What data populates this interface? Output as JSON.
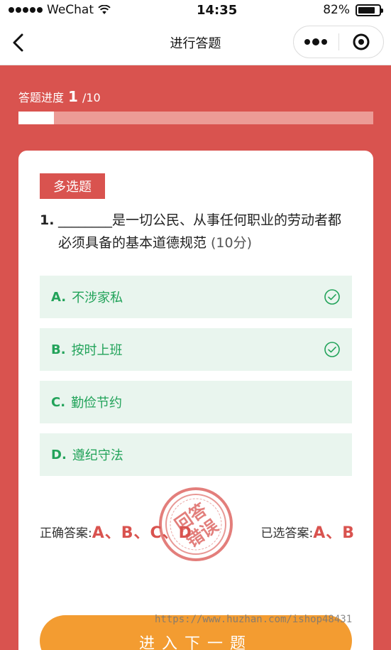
{
  "status_bar": {
    "carrier": "WeChat",
    "time": "14:35",
    "battery": "82%",
    "battery_level": 0.82
  },
  "nav": {
    "title": "进行答题"
  },
  "progress": {
    "label": "答题进度",
    "current": "1",
    "total": "/10",
    "fraction": 0.1
  },
  "question": {
    "type": "多选题",
    "number": "1.",
    "text": "________是一切公民、从事任何职业的劳动者都必须具备的基本道德规范",
    "score": "(10分)"
  },
  "options": [
    {
      "letter": "A.",
      "text": "不涉家私",
      "checked": true
    },
    {
      "letter": "B.",
      "text": "按时上班",
      "checked": true
    },
    {
      "letter": "C.",
      "text": "勤俭节约",
      "checked": false
    },
    {
      "letter": "D.",
      "text": "遵纪守法",
      "checked": false
    }
  ],
  "answers": {
    "correct_label": "正确答案:",
    "correct_value": "A、B、C、D",
    "selected_label": "已选答案:",
    "selected_value": "A、B"
  },
  "stamp": {
    "text": "回答错误"
  },
  "watermark": "https://www.huzhan.com/ishop48431",
  "next_button": "进入下一题",
  "colors": {
    "primary": "#d9534f",
    "option_bg": "#e9f5ee",
    "option_text": "#22a35a",
    "button": "#f39c31"
  }
}
